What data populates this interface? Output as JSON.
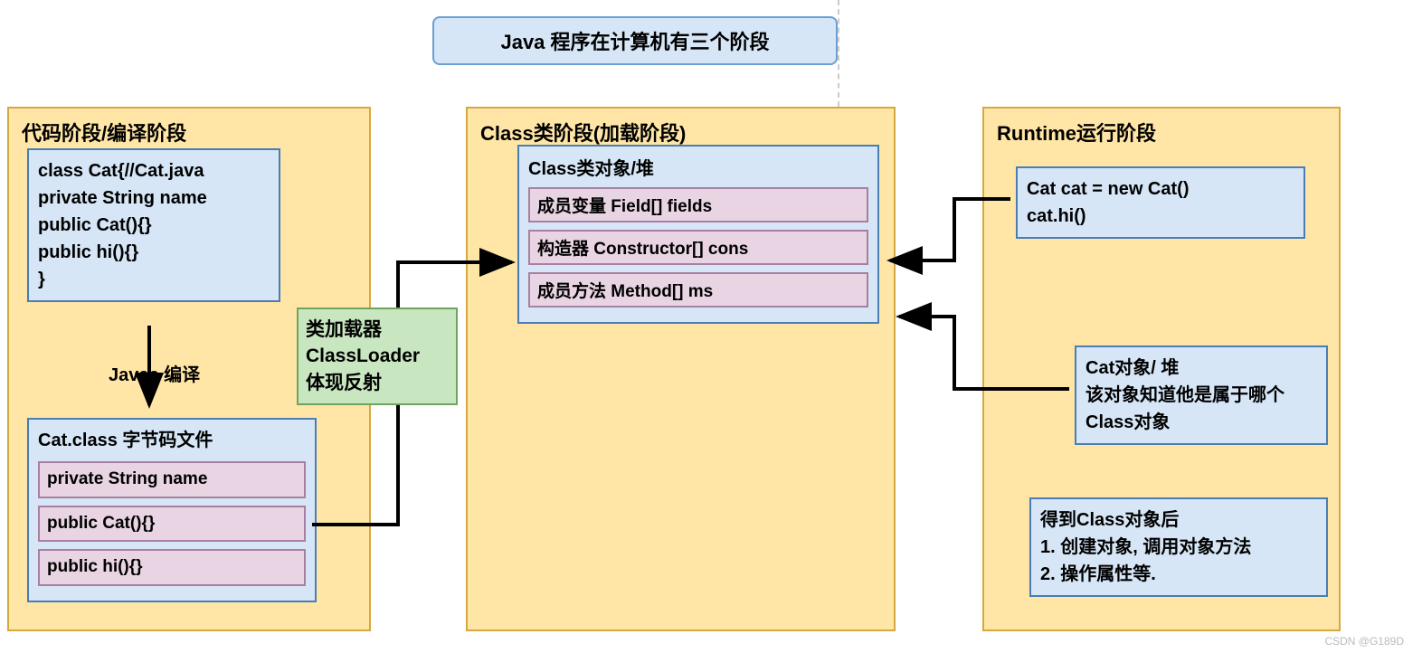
{
  "title": "Java 程序在计算机有三个阶段",
  "stage1": {
    "title": "代码阶段/编译阶段",
    "code": "class Cat{//Cat.java\nprivate String name\npublic Cat(){}\npublic hi(){}\n}",
    "javac_label": "Javac 编译",
    "bytecode_title": "Cat.class 字节码文件",
    "bytecode_items": [
      "private String name",
      "public Cat(){}",
      "public hi(){}"
    ]
  },
  "classloader": "类加载器\nClassLoader\n体现反射",
  "stage2": {
    "title": "Class类阶段(加载阶段)",
    "heap_title": "Class类对象/堆",
    "heap_items": [
      "成员变量 Field[] fields",
      "构造器 Constructor[] cons",
      "成员方法 Method[] ms"
    ]
  },
  "stage3": {
    "title": "Runtime运行阶段",
    "code": "Cat cat = new Cat()\ncat.hi()",
    "heap": "Cat对象/ 堆\n该对象知道他是属于哪个Class对象",
    "after": "得到Class对象后\n1. 创建对象, 调用对象方法\n2. 操作属性等."
  },
  "watermark": "CSDN @G189D"
}
